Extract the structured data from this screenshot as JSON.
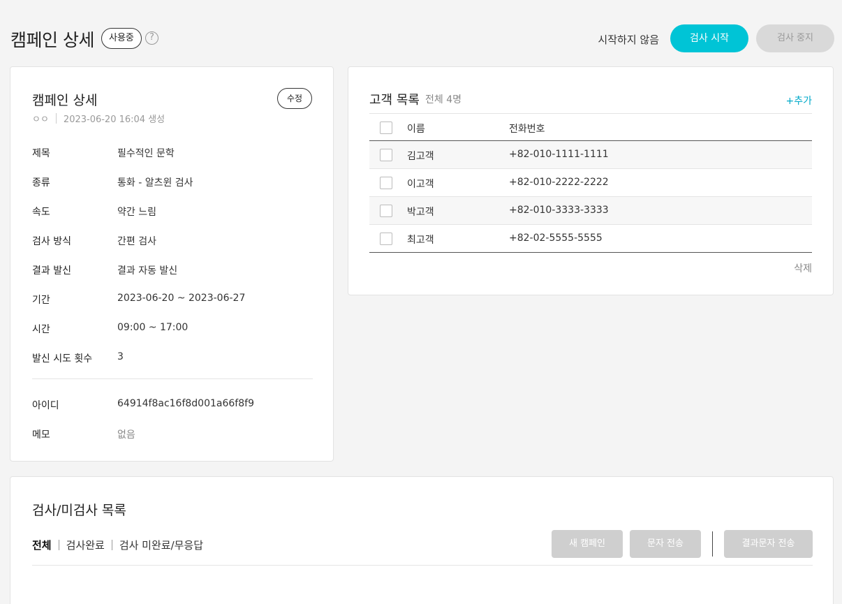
{
  "header": {
    "title": "캠페인 상세",
    "badge": "사용중",
    "help_glyph": "?",
    "status_text": "시작하지 않음",
    "start_button": "검사 시작",
    "stop_button": "검사 중지",
    "accent_color": "#00c4d6"
  },
  "detail": {
    "title": "캠페인 상세",
    "owner": "ㅇㅇ",
    "created": "2023-06-20 16:04 생성",
    "edit_button": "수정",
    "fields": [
      {
        "label": "제목",
        "value": "필수적인 문학"
      },
      {
        "label": "종류",
        "value": "통화 - 알츠윈 검사"
      },
      {
        "label": "속도",
        "value": "약간 느림"
      },
      {
        "label": "검사 방식",
        "value": "간편 검사"
      },
      {
        "label": "결과 발신",
        "value": "결과 자동 발신"
      },
      {
        "label": "기간",
        "value": "2023-06-20 ~ 2023-06-27"
      },
      {
        "label": "시간",
        "value": "09:00 ~ 17:00"
      },
      {
        "label": "발신 시도 횟수",
        "value": "3"
      }
    ],
    "extra_fields": [
      {
        "label": "아이디",
        "value": "64914f8ac16f8d001a66f8f9"
      },
      {
        "label": "메모",
        "value": "없음"
      }
    ]
  },
  "customers": {
    "title": "고객 목록",
    "count": "전체 4명",
    "add_link": "+추가",
    "columns": [
      "이름",
      "전화번호"
    ],
    "rows": [
      {
        "name": "김고객",
        "phone": "+82-010-1111-1111"
      },
      {
        "name": "이고객",
        "phone": "+82-010-2222-2222"
      },
      {
        "name": "박고객",
        "phone": "+82-010-3333-3333"
      },
      {
        "name": "최고객",
        "phone": "+82-02-5555-5555"
      }
    ],
    "delete_label": "삭제"
  },
  "inspection": {
    "title": "검사/미검사 목록",
    "tabs": [
      "전체",
      "검사완료",
      "검사 미완료/무응답"
    ],
    "new_campaign_button": "새 캠페인",
    "send_sms_button": "문자 전송",
    "send_result_sms_button": "결과문자 전송"
  }
}
